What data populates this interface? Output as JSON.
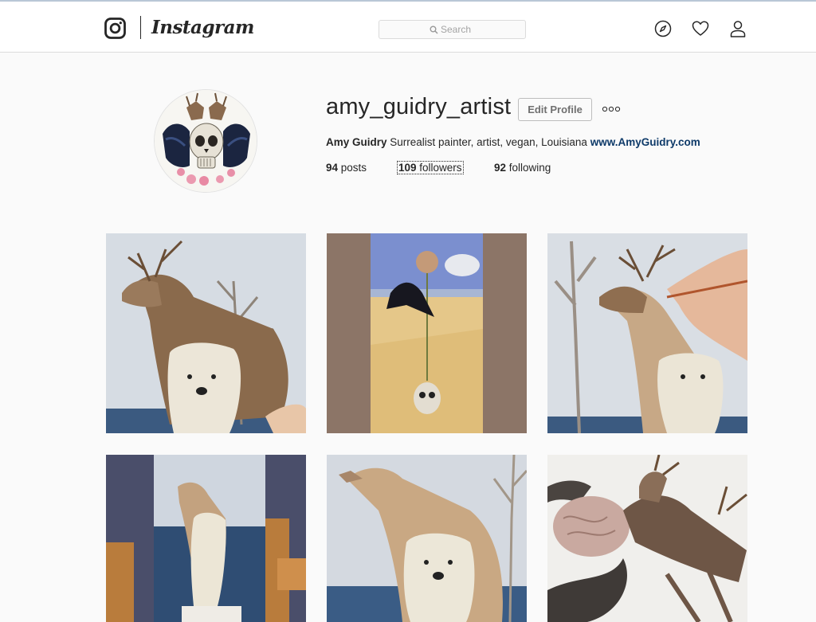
{
  "header": {
    "wordmark": "Instagram",
    "search_placeholder": "Search",
    "icons": [
      "instagram-logo-icon",
      "explore-compass-icon",
      "activity-heart-icon",
      "profile-person-icon"
    ]
  },
  "profile": {
    "username": "amy_guidry_artist",
    "edit_button": "Edit Profile",
    "more_icon": "ellipsis-icon",
    "full_name": "Amy Guidry",
    "bio": " Surrealist painter, artist, vegan, Louisiana ",
    "website": "www.AmyGuidry.com",
    "stats": {
      "posts_count": "94",
      "posts_label": " posts",
      "followers_count": "109",
      "followers_label": " followers",
      "following_count": "92",
      "following_label": " following"
    }
  },
  "colors": {
    "link": "#0e3a69",
    "border": "#dbdbdb",
    "background": "#fafafa"
  },
  "posts": [
    {
      "subject": "deer-with-polar-bear-painting"
    },
    {
      "subject": "raven-flower-skull-desert-painting"
    },
    {
      "subject": "hand-painting-deer-polar-bear"
    },
    {
      "subject": "easel-deer-polar-bear-studio"
    },
    {
      "subject": "deer-polar-bear-close-up"
    },
    {
      "subject": "deer-brain-horns-painting"
    }
  ]
}
